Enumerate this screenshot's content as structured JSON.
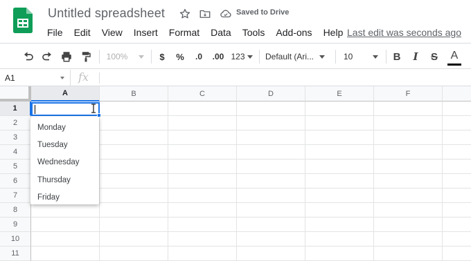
{
  "app": {
    "title": "Untitled spreadsheet",
    "save_status": "Saved to Drive",
    "last_edit": "Last edit was seconds ago"
  },
  "menu": [
    "File",
    "Edit",
    "View",
    "Insert",
    "Format",
    "Data",
    "Tools",
    "Add-ons",
    "Help"
  ],
  "toolbar": {
    "zoom": "100%",
    "currency": "$",
    "percent": "%",
    "decrease_decimal": ".0",
    "increase_decimal": ".00",
    "more_formats": "123",
    "font": "Default (Ari...",
    "font_size": "10",
    "bold": "B",
    "italic": "I",
    "strikethrough": "S",
    "text_color": "A"
  },
  "formula_bar": {
    "cell_ref": "A1",
    "fx": "fx",
    "value": ""
  },
  "grid": {
    "columns": [
      "A",
      "B",
      "C",
      "D",
      "E",
      "F"
    ],
    "rows": [
      "1",
      "2",
      "3",
      "4",
      "5",
      "6",
      "7",
      "8",
      "9",
      "10",
      "11"
    ],
    "selected_column": "A",
    "selected_row": "1",
    "active_cell_value": ""
  },
  "autocomplete": [
    "Monday",
    "Tuesday",
    "Wednesday",
    "Thursday",
    "Friday"
  ],
  "colors": {
    "accent": "#1a73e8",
    "sheets_green": "#0f9d58",
    "text_color_bar": "#000000"
  }
}
